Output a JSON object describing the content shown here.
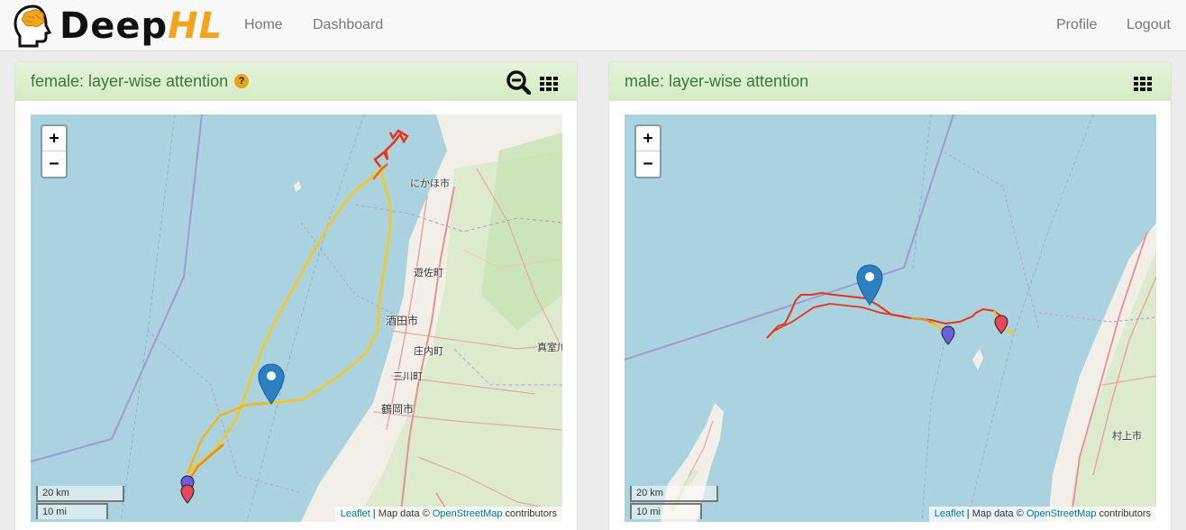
{
  "navbar": {
    "brand_part1": "Deep",
    "brand_part2": "HL",
    "links": {
      "home": "Home",
      "dashboard": "Dashboard",
      "profile": "Profile",
      "logout": "Logout"
    }
  },
  "panels": [
    {
      "title": "female: layer-wise attention",
      "help_badge": "?",
      "map": {
        "zoom_in": "+",
        "zoom_out": "−",
        "scale_km": "20 km",
        "scale_mi": "10 mi",
        "attribution": {
          "leaflet": "Leaflet",
          "sep": " | Map data © ",
          "osm": "OpenStreetMap",
          "tail": " contributors"
        },
        "place_labels": [
          "にかほ市",
          "遊佐町",
          "酒田市",
          "庄内町",
          "三川町",
          "鶴岡市",
          "真室川"
        ]
      }
    },
    {
      "title": "male: layer-wise attention",
      "map": {
        "zoom_in": "+",
        "zoom_out": "−",
        "scale_km": "20 km",
        "scale_mi": "10 mi",
        "attribution": {
          "leaflet": "Leaflet",
          "sep": " | Map data © ",
          "osm": "OpenStreetMap",
          "tail": " contributors"
        },
        "place_labels": [
          "村上市"
        ]
      }
    }
  ],
  "colors": {
    "panel_title": "#3c763d",
    "brand_accent": "#f2a51a",
    "sea": "#aad3df",
    "land": "#f2efe9",
    "marker_blue": "#2c7fc0",
    "start_marker": "#6a5fdc",
    "end_marker": "#e8465a",
    "track_high": "#e8321a",
    "track_low": "#f5d01a"
  },
  "icons": {
    "zoom_tool": "search-minus-icon",
    "grid_tool": "grid-icon",
    "logo": "brain-head-icon",
    "marker": "map-marker-icon"
  }
}
